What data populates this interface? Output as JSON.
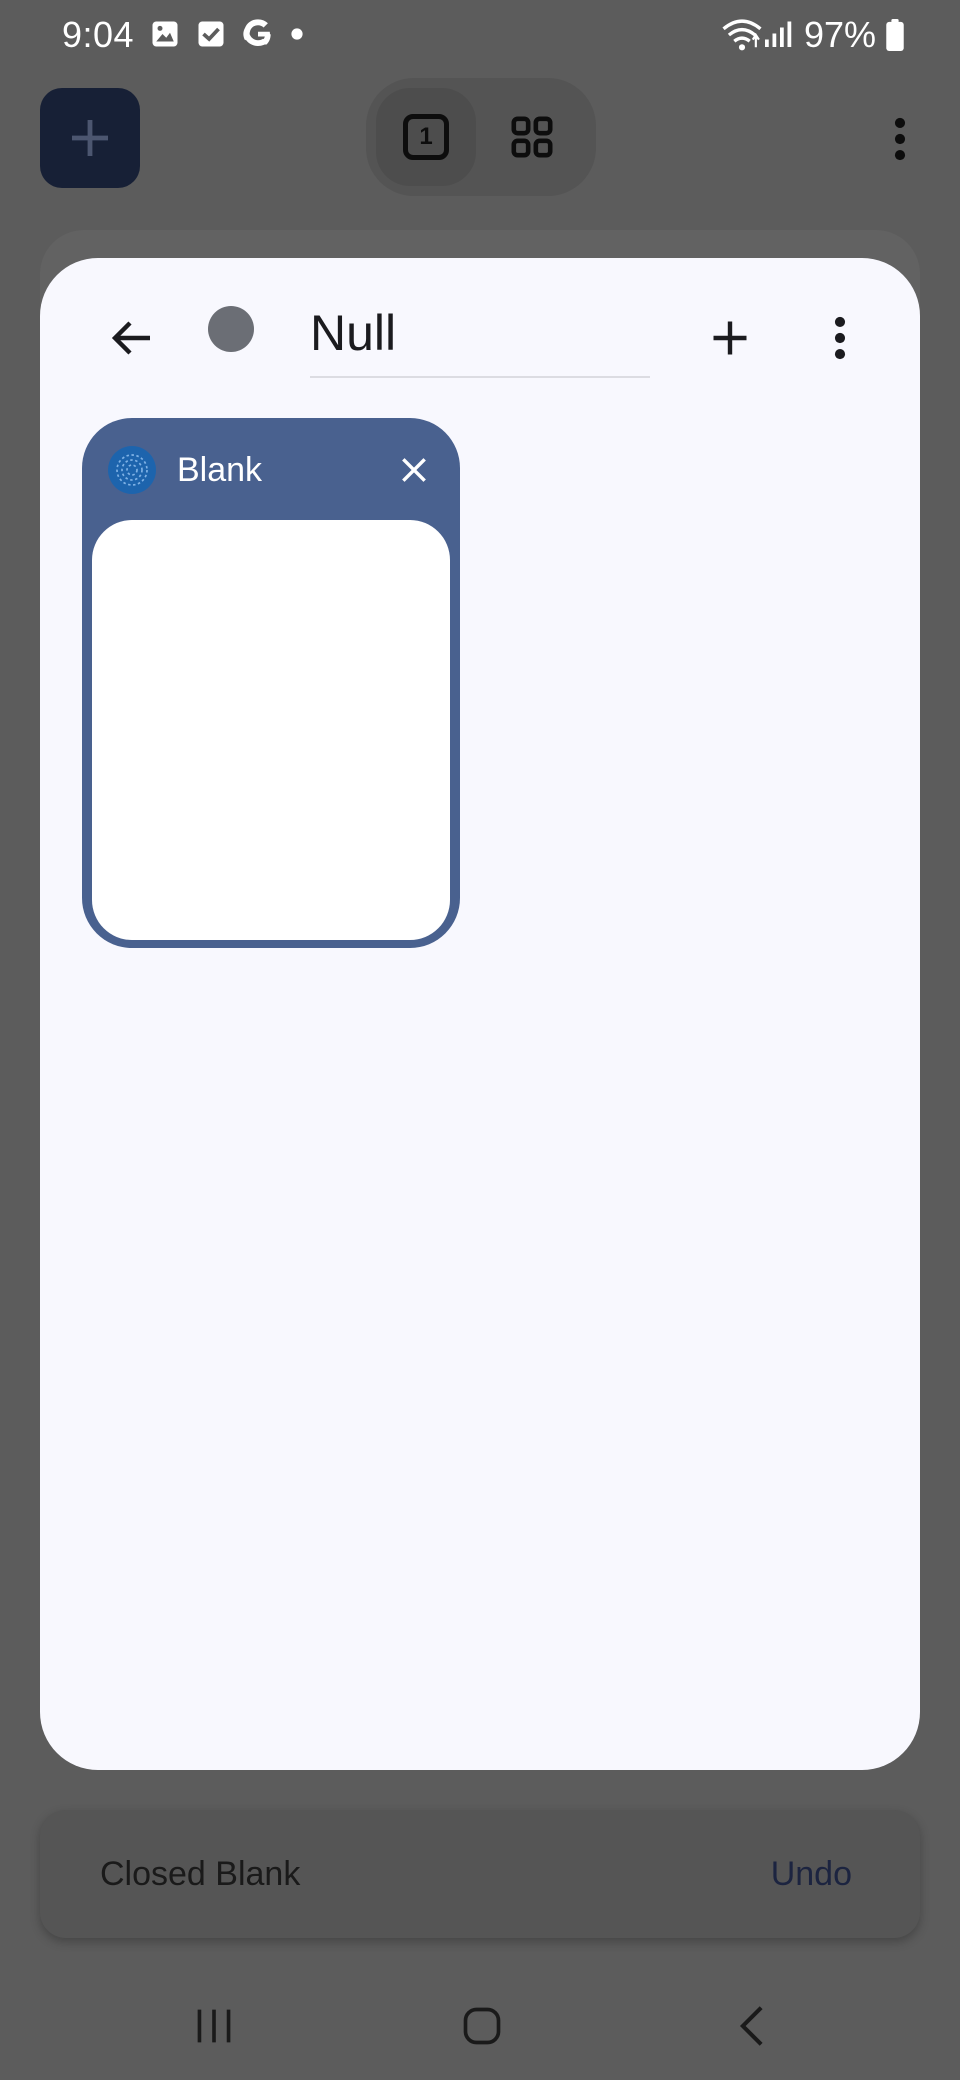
{
  "status_bar": {
    "time": "9:04",
    "battery": "97%",
    "notification_icons": [
      "image-icon",
      "check-box-icon",
      "google-icon",
      "dot-icon"
    ],
    "system_icons": [
      "wifi-icon",
      "signal-icon",
      "battery-icon"
    ]
  },
  "toolbar": {
    "new_tab_icon": "plus-icon",
    "tab_count": "1",
    "grid_icon": "grid-icon",
    "menu_icon": "more-vert-icon"
  },
  "group": {
    "title": "Null",
    "color": "#6b6e75",
    "back_icon": "arrow-back-icon",
    "add_icon": "plus-icon",
    "menu_icon": "more-vert-icon"
  },
  "tabs": [
    {
      "title": "Blank",
      "favicon": "globe-icon",
      "close_icon": "close-icon",
      "color": "#49618f"
    }
  ],
  "snackbar": {
    "message": "Closed Blank",
    "action": "Undo"
  },
  "nav_bar": {
    "icons": [
      "recents-icon",
      "home-icon",
      "back-icon"
    ]
  }
}
